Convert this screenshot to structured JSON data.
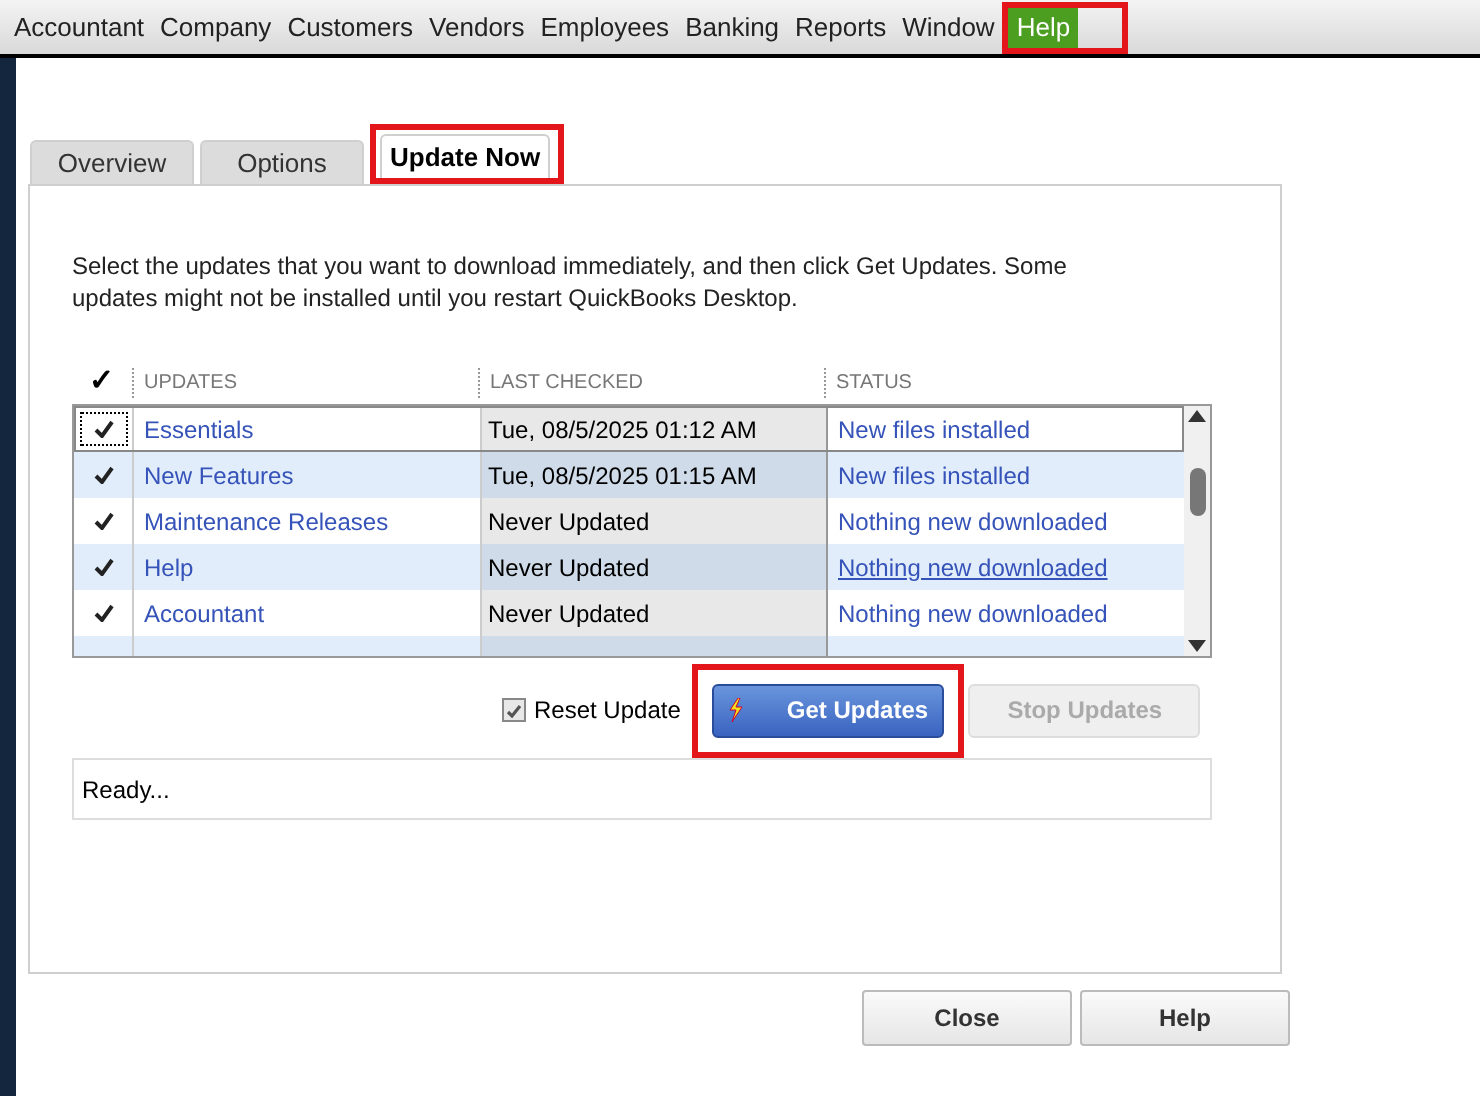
{
  "menu_bar": [
    {
      "label": "Accountant",
      "selected": false,
      "highlighted": false
    },
    {
      "label": "Company",
      "selected": false,
      "highlighted": false
    },
    {
      "label": "Customers",
      "selected": false,
      "highlighted": false
    },
    {
      "label": "Vendors",
      "selected": false,
      "highlighted": false
    },
    {
      "label": "Employees",
      "selected": false,
      "highlighted": false
    },
    {
      "label": "Banking",
      "selected": false,
      "highlighted": false
    },
    {
      "label": "Reports",
      "selected": false,
      "highlighted": false
    },
    {
      "label": "Window",
      "selected": false,
      "highlighted": false
    },
    {
      "label": "Help",
      "selected": true,
      "highlighted": true
    }
  ],
  "tabs": [
    {
      "label": "Overview",
      "selected": false,
      "highlighted": false
    },
    {
      "label": "Options",
      "selected": false,
      "highlighted": false
    },
    {
      "label": "Update Now",
      "selected": true,
      "highlighted": true
    }
  ],
  "instructions": "Select the updates that you want to download immediately, and then click Get Updates. Some updates might not be installed until you restart QuickBooks Desktop.",
  "table": {
    "check_header": "✓",
    "columns": [
      "UPDATES",
      "LAST CHECKED",
      "STATUS"
    ],
    "rows": [
      {
        "checked": true,
        "selected": true,
        "name": "Essentials",
        "last_checked": "Tue, 08/5/2025 01:12 AM",
        "status": "New files installed",
        "underlined": false
      },
      {
        "checked": true,
        "selected": false,
        "name": "New Features",
        "last_checked": "Tue, 08/5/2025 01:15 AM",
        "status": "New files installed",
        "underlined": false
      },
      {
        "checked": true,
        "selected": false,
        "name": "Maintenance Releases",
        "last_checked": "Never Updated",
        "status": "Nothing new downloaded",
        "underlined": false
      },
      {
        "checked": true,
        "selected": false,
        "name": "Help",
        "last_checked": "Never Updated",
        "status": "Nothing new downloaded",
        "underlined": true
      },
      {
        "checked": true,
        "selected": false,
        "name": "Accountant",
        "last_checked": "Never Updated",
        "status": "Nothing new downloaded",
        "underlined": false
      }
    ]
  },
  "reset_update": {
    "label": "Reset Update",
    "checked": true
  },
  "get_updates": {
    "label": "Get Updates",
    "highlighted": true,
    "disabled": false
  },
  "stop_updates": {
    "label": "Stop Updates",
    "disabled": true
  },
  "status_box": "Ready...",
  "buttons": [
    "Close",
    "Help"
  ]
}
